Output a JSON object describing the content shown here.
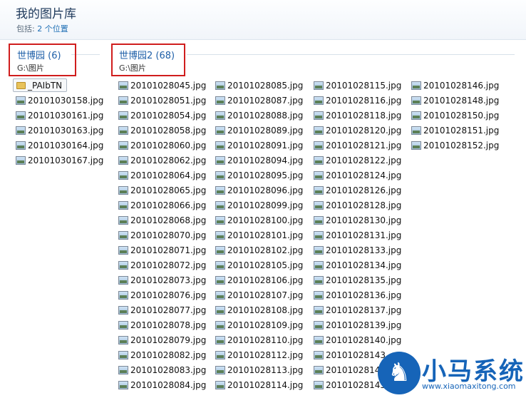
{
  "header": {
    "title": "我的图片库",
    "includes_label": "包括:",
    "includes_link": "2 个位置"
  },
  "groups": [
    {
      "name": "世博园 (6)",
      "path": "G:\\图片",
      "items": [
        {
          "name": "_PAIbTN",
          "type": "folder"
        },
        {
          "name": "20101030158.jpg",
          "type": "image"
        },
        {
          "name": "20101030161.jpg",
          "type": "image"
        },
        {
          "name": "20101030163.jpg",
          "type": "image"
        },
        {
          "name": "20101030164.jpg",
          "type": "image"
        },
        {
          "name": "20101030167.jpg",
          "type": "image"
        }
      ]
    },
    {
      "name": "世博园2 (68)",
      "path": "G:\\图片",
      "columns": [
        [
          "20101028045.jpg",
          "20101028051.jpg",
          "20101028054.jpg",
          "20101028058.jpg",
          "20101028060.jpg",
          "20101028062.jpg",
          "20101028064.jpg",
          "20101028065.jpg",
          "20101028066.jpg",
          "20101028068.jpg",
          "20101028070.jpg",
          "20101028071.jpg",
          "20101028072.jpg",
          "20101028073.jpg",
          "20101028076.jpg",
          "20101028077.jpg",
          "20101028078.jpg",
          "20101028079.jpg",
          "20101028082.jpg",
          "20101028083.jpg",
          "20101028084.jpg"
        ],
        [
          "20101028085.jpg",
          "20101028087.jpg",
          "20101028088.jpg",
          "20101028089.jpg",
          "20101028091.jpg",
          "20101028094.jpg",
          "20101028095.jpg",
          "20101028096.jpg",
          "20101028099.jpg",
          "20101028100.jpg",
          "20101028101.jpg",
          "20101028102.jpg",
          "20101028105.jpg",
          "20101028106.jpg",
          "20101028107.jpg",
          "20101028108.jpg",
          "20101028109.jpg",
          "20101028110.jpg",
          "20101028112.jpg",
          "20101028113.jpg",
          "20101028114.jpg"
        ],
        [
          "20101028115.jpg",
          "20101028116.jpg",
          "20101028118.jpg",
          "20101028120.jpg",
          "20101028121.jpg",
          "20101028122.jpg",
          "20101028124.jpg",
          "20101028126.jpg",
          "20101028128.jpg",
          "20101028130.jpg",
          "20101028131.jpg",
          "20101028133.jpg",
          "20101028134.jpg",
          "20101028135.jpg",
          "20101028136.jpg",
          "20101028137.jpg",
          "20101028139.jpg",
          "20101028140.jpg",
          "20101028143",
          "20101028144",
          "20101028145"
        ],
        [
          "20101028146.jpg",
          "20101028148.jpg",
          "20101028150.jpg",
          "20101028151.jpg",
          "20101028152.jpg"
        ]
      ]
    }
  ],
  "highlight_color": "#d01d1d",
  "watermark": {
    "name": "小马系统",
    "url": "www.xiaomaxitong.com",
    "icon": "horse-logo"
  }
}
